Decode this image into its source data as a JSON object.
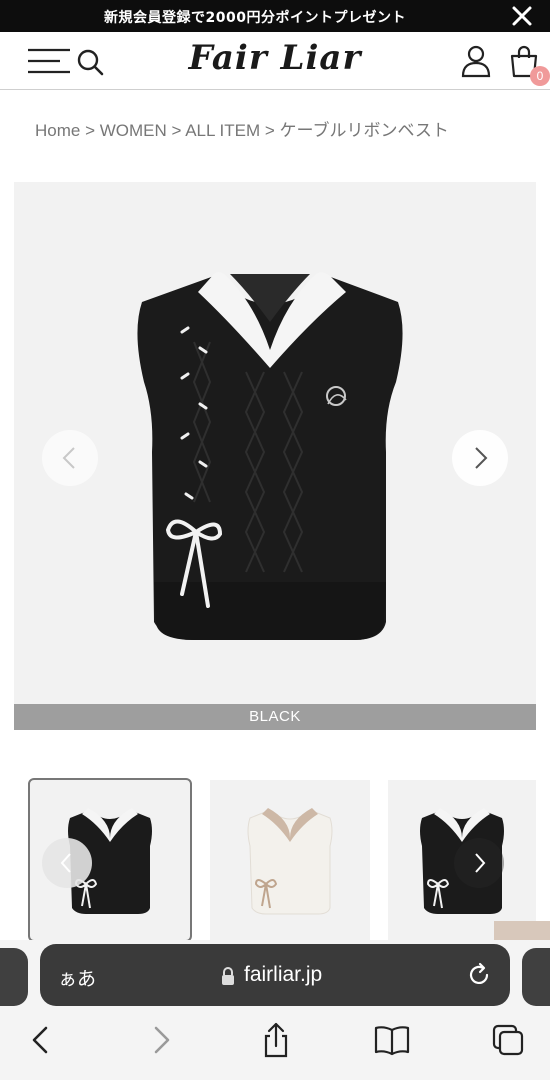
{
  "promo": {
    "text": "新規会員登録で2000円分ポイントプレゼント"
  },
  "header": {
    "logo": "Fair Liar",
    "cart_count": "0"
  },
  "breadcrumb": [
    "Home",
    "WOMEN",
    "ALL ITEM",
    "ケーブルリボンベスト"
  ],
  "breadcrumb_separator": " > ",
  "product": {
    "color_label": "BLACK"
  },
  "safari": {
    "aa_label": "ぁあ",
    "url": "fairliar.jp"
  },
  "colors": {
    "vest_black": "#1b1b1b",
    "vest_white": "#f3f1ec",
    "rib_white": "#f5f5f5",
    "beige_trim": "#cdb8a6",
    "badge": "#f09a9a"
  }
}
